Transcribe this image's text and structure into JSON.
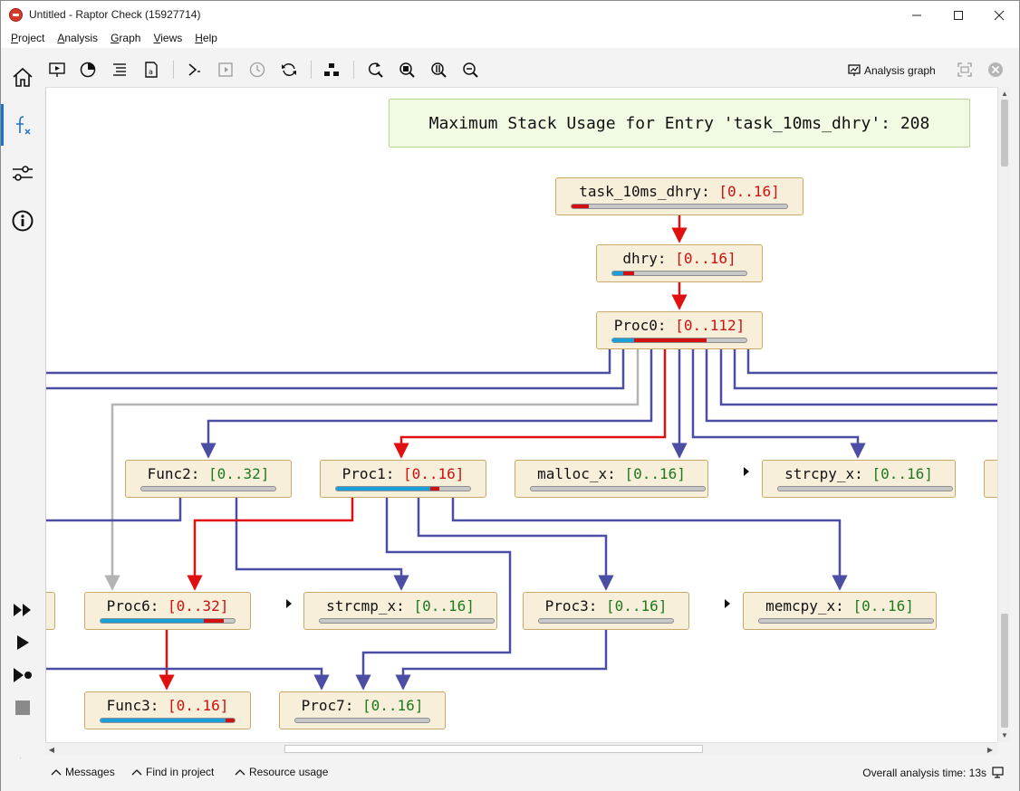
{
  "window": {
    "title": "Untitled - Raptor Check (15927714)"
  },
  "menu": [
    "Project",
    "Analysis",
    "Graph",
    "Views",
    "Help"
  ],
  "toolbar": {
    "analysis_graph_label": "Analysis graph"
  },
  "banner": {
    "text": "Maximum Stack Usage for Entry 'task_10ms_dhry': 208"
  },
  "nodes": [
    {
      "id": "task_10ms_dhry",
      "name": "task_10ms_dhry:",
      "range": "[0..16]",
      "range_color": "red",
      "bar": [
        {
          "kind": "red",
          "from": 0.0,
          "to": 0.08
        }
      ]
    },
    {
      "id": "dhry",
      "name": "dhry:",
      "range": "[0..16]",
      "range_color": "red",
      "bar": [
        {
          "kind": "blue",
          "from": 0.0,
          "to": 0.08
        },
        {
          "kind": "red",
          "from": 0.08,
          "to": 0.16
        }
      ]
    },
    {
      "id": "Proc0",
      "name": "Proc0:",
      "range": "[0..112]",
      "range_color": "red",
      "bar": [
        {
          "kind": "blue",
          "from": 0.0,
          "to": 0.16
        },
        {
          "kind": "red",
          "from": 0.16,
          "to": 0.7
        }
      ]
    },
    {
      "id": "Func2",
      "name": "Func2:",
      "range": "[0..32]",
      "range_color": "green",
      "bar": []
    },
    {
      "id": "Proc1",
      "name": "Proc1:",
      "range": "[0..16]",
      "range_color": "red",
      "bar": [
        {
          "kind": "blue",
          "from": 0.0,
          "to": 0.7
        },
        {
          "kind": "red",
          "from": 0.7,
          "to": 0.77
        }
      ]
    },
    {
      "id": "malloc_x",
      "name": "malloc_x:",
      "range": "[0..16]",
      "range_color": "green",
      "bar": []
    },
    {
      "id": "strcpy_x",
      "name": "strcpy_x:",
      "range": "[0..16]",
      "range_color": "green",
      "bar": []
    },
    {
      "id": "Proc6",
      "name": "Proc6:",
      "range": "[0..32]",
      "range_color": "red",
      "bar": [
        {
          "kind": "blue",
          "from": 0.0,
          "to": 0.77
        },
        {
          "kind": "red",
          "from": 0.77,
          "to": 0.92
        }
      ]
    },
    {
      "id": "strcmp_x",
      "name": "strcmp_x:",
      "range": "[0..16]",
      "range_color": "green",
      "bar": []
    },
    {
      "id": "Proc3",
      "name": "Proc3:",
      "range": "[0..16]",
      "range_color": "green",
      "bar": []
    },
    {
      "id": "memcpy_x",
      "name": "memcpy_x:",
      "range": "[0..16]",
      "range_color": "green",
      "bar": []
    },
    {
      "id": "Func3",
      "name": "Func3:",
      "range": "[0..16]",
      "range_color": "red",
      "bar": [
        {
          "kind": "blue",
          "from": 0.0,
          "to": 0.93
        },
        {
          "kind": "red",
          "from": 0.93,
          "to": 1.0
        }
      ]
    },
    {
      "id": "Proc7",
      "name": "Proc7:",
      "range": "[0..16]",
      "range_color": "green",
      "bar": []
    }
  ],
  "colors": {
    "edge_blue": "#4b4ea3",
    "edge_red": "#e01010",
    "edge_gray": "#b4b4b4",
    "node_fill": "#f7efd9",
    "banner_fill": "#f1fae3"
  },
  "status": {
    "messages": "Messages",
    "find_in_project": "Find in project",
    "resource_usage": "Resource usage",
    "analysis_time": "Overall analysis time: 13s"
  }
}
